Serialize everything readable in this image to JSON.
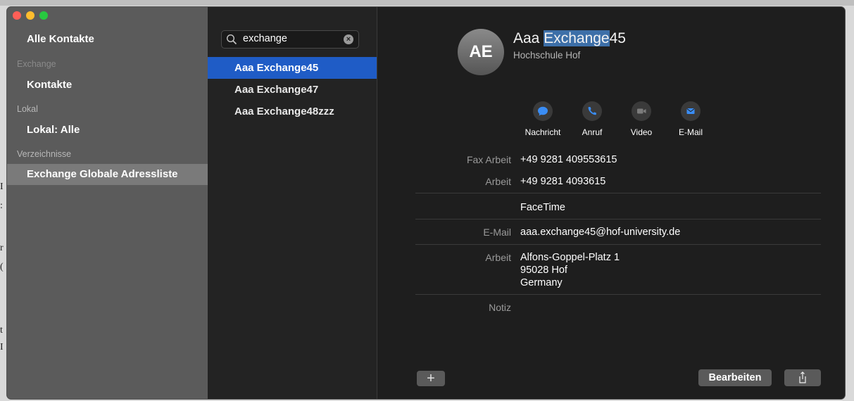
{
  "sidebar": {
    "all_contacts": "Alle Kontakte",
    "groups": [
      {
        "header": "Exchange",
        "item": "Kontakte"
      },
      {
        "header": "Lokal",
        "item": "Lokal: Alle"
      },
      {
        "header": "Verzeichnisse",
        "item": "Exchange Globale Adressliste"
      }
    ]
  },
  "search": {
    "value": "exchange"
  },
  "contacts": [
    "Aaa Exchange45",
    "Aaa Exchange47",
    "Aaa Exchange48zzz"
  ],
  "detail": {
    "initials": "AE",
    "name_prefix": "Aaa ",
    "name_highlight": "Exchange",
    "name_suffix": "45",
    "company": "Hochschule Hof",
    "actions": [
      {
        "label": "Nachricht",
        "icon": "message-icon"
      },
      {
        "label": "Anruf",
        "icon": "phone-icon"
      },
      {
        "label": "Video",
        "icon": "video-icon"
      },
      {
        "label": "E-Mail",
        "icon": "mail-icon"
      }
    ],
    "fields": [
      {
        "label": "Fax Arbeit",
        "value": "+49 9281 409553615"
      },
      {
        "label": "Arbeit",
        "value": "+49 9281 4093615"
      },
      {
        "label": "",
        "value": "FaceTime"
      },
      {
        "label": "E-Mail",
        "value": "aaa.exchange45@hof-university.de"
      },
      {
        "label": "Arbeit",
        "value_lines": [
          "Alfons-Goppel-Platz 1",
          "95028 Hof",
          "Germany"
        ]
      },
      {
        "label": "Notiz",
        "value": ""
      }
    ]
  },
  "footer": {
    "add_label": "+",
    "edit_label": "Bearbeiten",
    "share_icon": "share-icon"
  }
}
